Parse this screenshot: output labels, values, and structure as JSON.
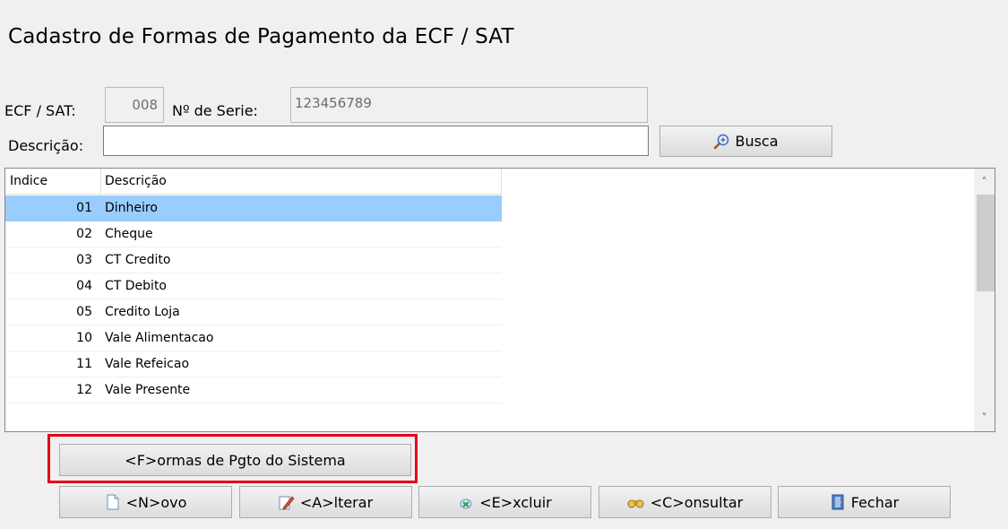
{
  "title": "Cadastro de Formas de Pagamento da ECF / SAT",
  "ecf_label": "ECF / SAT:",
  "ecf_value": "008",
  "serie_label": "Nº de Serie:",
  "serie_value": "123456789",
  "descricao_label": "Descrição:",
  "descricao_value": "",
  "busca_label": "Busca",
  "grid": {
    "col_indice": "Indice",
    "col_descricao": "Descrição",
    "rows": [
      {
        "idx": "01",
        "desc": "Dinheiro"
      },
      {
        "idx": "02",
        "desc": "Cheque"
      },
      {
        "idx": "03",
        "desc": "CT Credito"
      },
      {
        "idx": "04",
        "desc": "CT Debito"
      },
      {
        "idx": "05",
        "desc": "Credito Loja"
      },
      {
        "idx": "10",
        "desc": "Vale Alimentacao"
      },
      {
        "idx": "11",
        "desc": "Vale Refeicao"
      },
      {
        "idx": "12",
        "desc": "Vale Presente"
      }
    ]
  },
  "formas_sistema_label": "<F>ormas de Pgto do Sistema",
  "buttons": {
    "novo": "<N>ovo",
    "alterar": "<A>lterar",
    "excluir": "<E>xcluir",
    "consultar": "<C>onsultar",
    "fechar": "Fechar"
  },
  "colors": {
    "selection": "#99ccff",
    "highlight_box": "#e3001b"
  }
}
